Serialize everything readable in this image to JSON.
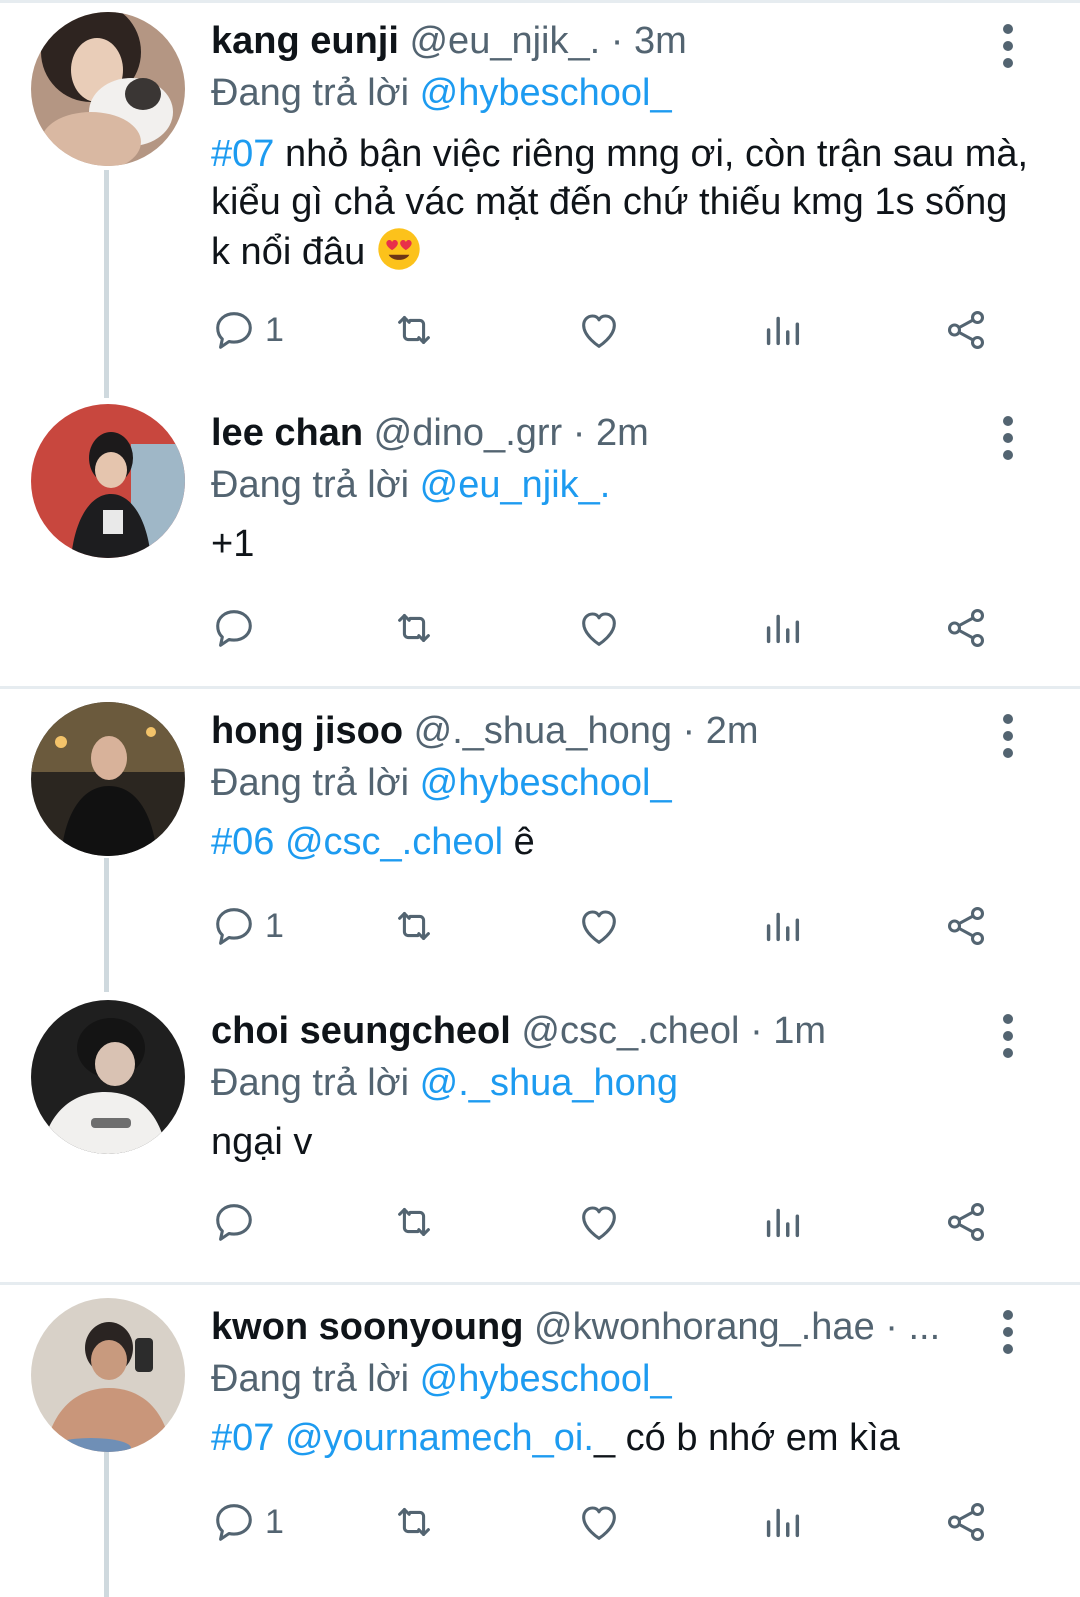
{
  "colors": {
    "link": "#1d9bf0",
    "muted": "#536471",
    "divider": "#e6ecf0",
    "thread_line": "#cfd9de"
  },
  "replying_label": "Đang trả lời",
  "tweets": [
    {
      "name": "kang eunji",
      "handle": "@eu_njik_.",
      "dot": "·",
      "time": "3m",
      "reply_to": "@hybeschool_",
      "tag": "#07",
      "text": " nhỏ bận việc riêng mng ơi, còn trận sau mà, kiểu gì chả vác mặt đến chứ thiếu kmg 1s sống k nổi đâu",
      "emoji": "heart-eyes-emoji",
      "reply_count": "1"
    },
    {
      "name": "lee chan",
      "handle": "@dino_.grr",
      "dot": "·",
      "time": "2m",
      "reply_to": "@eu_njik_.",
      "text": "+1",
      "reply_count": ""
    },
    {
      "name": "hong jisoo",
      "handle": "@._shua_hong",
      "dot": "·",
      "time": "2m",
      "reply_to": "@hybeschool_",
      "tag": "#06",
      "mention": "@csc_.cheol",
      "text": " ê",
      "reply_count": "1"
    },
    {
      "name": "choi seungcheol",
      "handle": "@csc_.cheol",
      "dot": "·",
      "time": "1m",
      "reply_to": "@._shua_hong",
      "text": "ngại v",
      "reply_count": ""
    },
    {
      "name": "kwon soonyoung",
      "handle": "@kwonhorang_.hae",
      "dot": "· ...",
      "time": "",
      "reply_to": "@hybeschool_",
      "tag": "#07",
      "mention": "@yournamech_oi.",
      "text": "_ có b nhớ em kìa",
      "reply_count": "1"
    }
  ],
  "icons": [
    "reply-icon",
    "retweet-icon",
    "like-icon",
    "views-icon",
    "share-icon",
    "more-icon"
  ]
}
